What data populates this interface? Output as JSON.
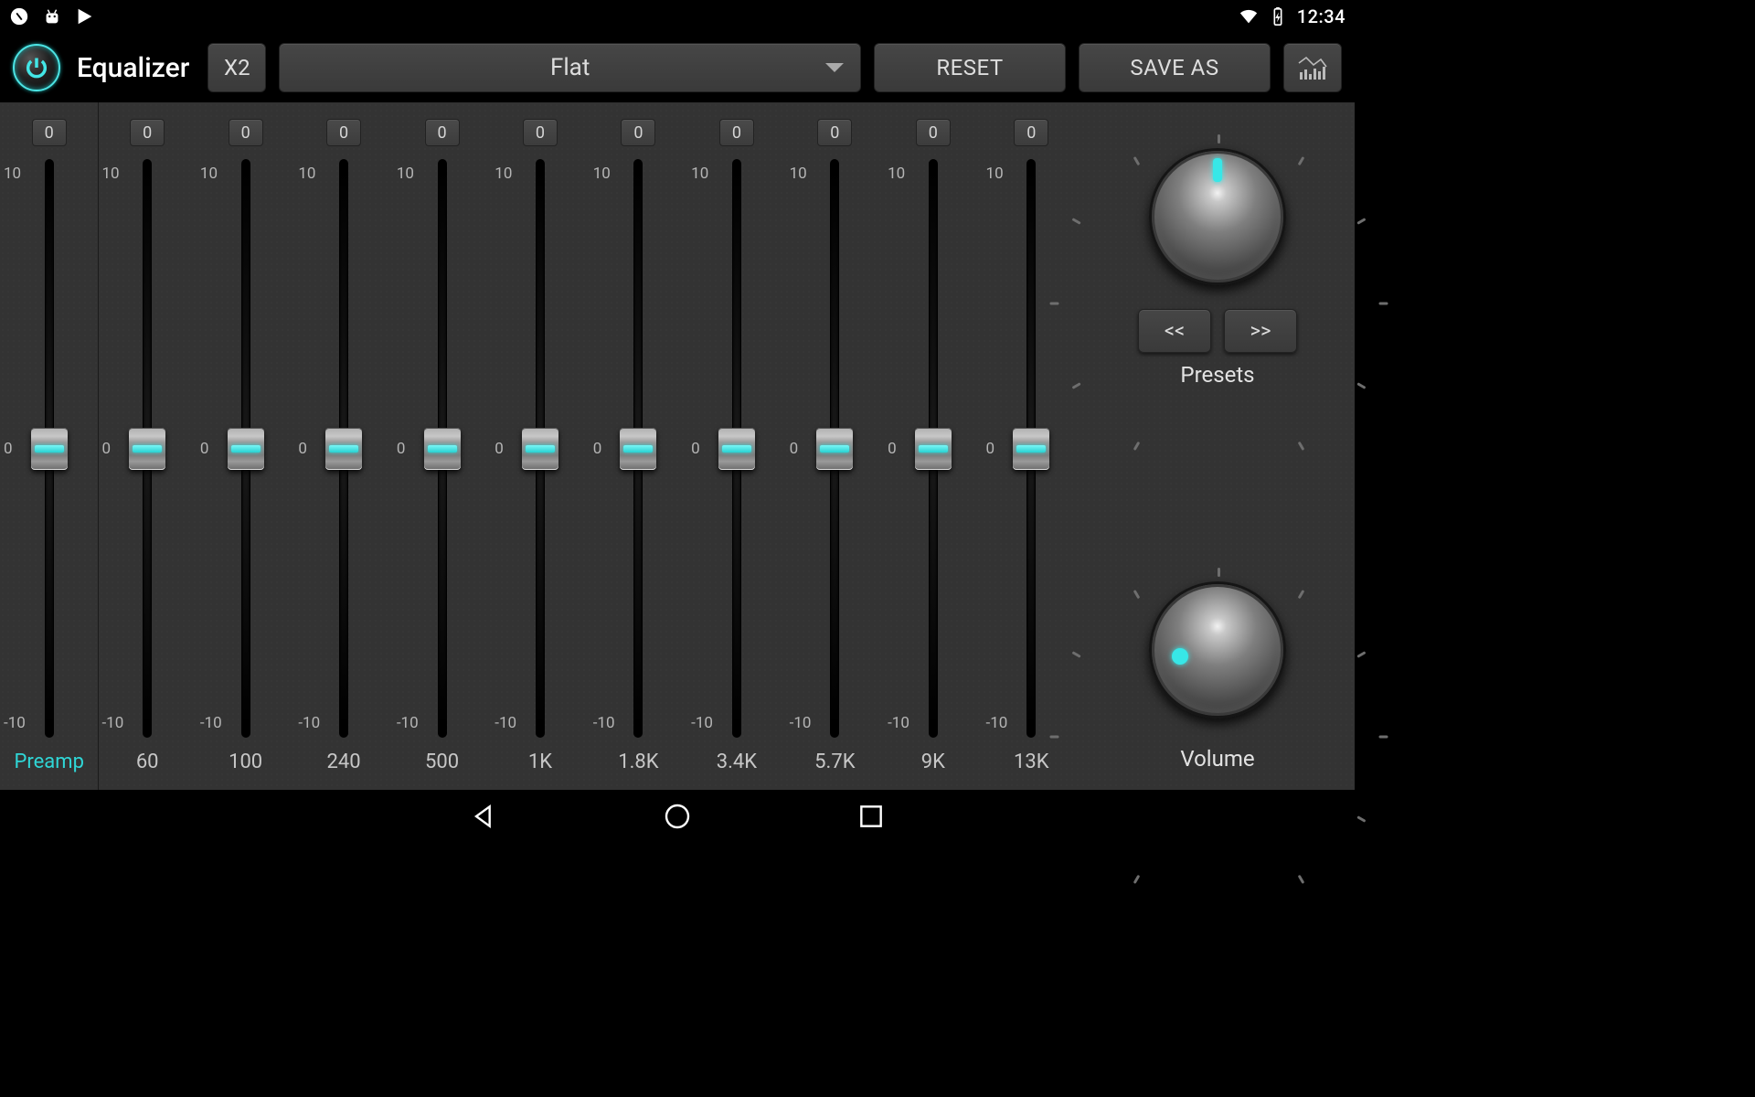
{
  "status": {
    "time": "12:34"
  },
  "toolbar": {
    "title": "Equalizer",
    "x2_label": "X2",
    "preset_selected": "Flat",
    "reset_label": "RESET",
    "saveas_label": "SAVE AS"
  },
  "eq": {
    "scale_top": "10",
    "scale_mid": "0",
    "scale_bot": "-10",
    "bands": [
      {
        "id": "preamp",
        "value": "0",
        "label": "Preamp"
      },
      {
        "id": "60",
        "value": "0",
        "label": "60"
      },
      {
        "id": "100",
        "value": "0",
        "label": "100"
      },
      {
        "id": "240",
        "value": "0",
        "label": "240"
      },
      {
        "id": "500",
        "value": "0",
        "label": "500"
      },
      {
        "id": "1k",
        "value": "0",
        "label": "1K"
      },
      {
        "id": "1_8k",
        "value": "0",
        "label": "1.8K"
      },
      {
        "id": "3_4k",
        "value": "0",
        "label": "3.4K"
      },
      {
        "id": "5_7k",
        "value": "0",
        "label": "5.7K"
      },
      {
        "id": "9k",
        "value": "0",
        "label": "9K"
      },
      {
        "id": "13k",
        "value": "0",
        "label": "13K"
      }
    ]
  },
  "presets": {
    "prev_label": "<<",
    "next_label": ">>",
    "caption": "Presets"
  },
  "volume": {
    "caption": "Volume"
  }
}
